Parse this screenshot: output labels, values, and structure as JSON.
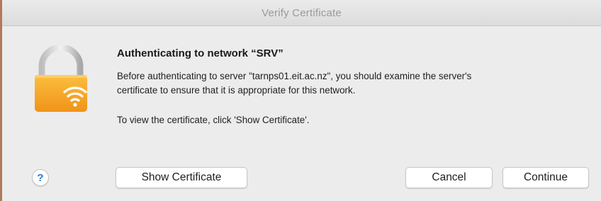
{
  "window": {
    "title": "Verify Certificate"
  },
  "content": {
    "heading": "Authenticating to network “SRV”",
    "message_line1": "Before authenticating to server \"tarnps01.eit.ac.nz\", you should examine the server's",
    "message_line2": "certificate to ensure that it is appropriate for this network.",
    "instruction": "To view the certificate, click 'Show Certificate'."
  },
  "buttons": {
    "help": "?",
    "show_certificate": "Show Certificate",
    "cancel": "Cancel",
    "continue": "Continue"
  },
  "icons": {
    "main": "wifi-lock-icon",
    "help": "help-icon"
  },
  "colors": {
    "lock_body": "#f5a623",
    "lock_shackle": "#d8d8d8",
    "wifi": "#ffffff",
    "accent": "#2a7ad6"
  }
}
